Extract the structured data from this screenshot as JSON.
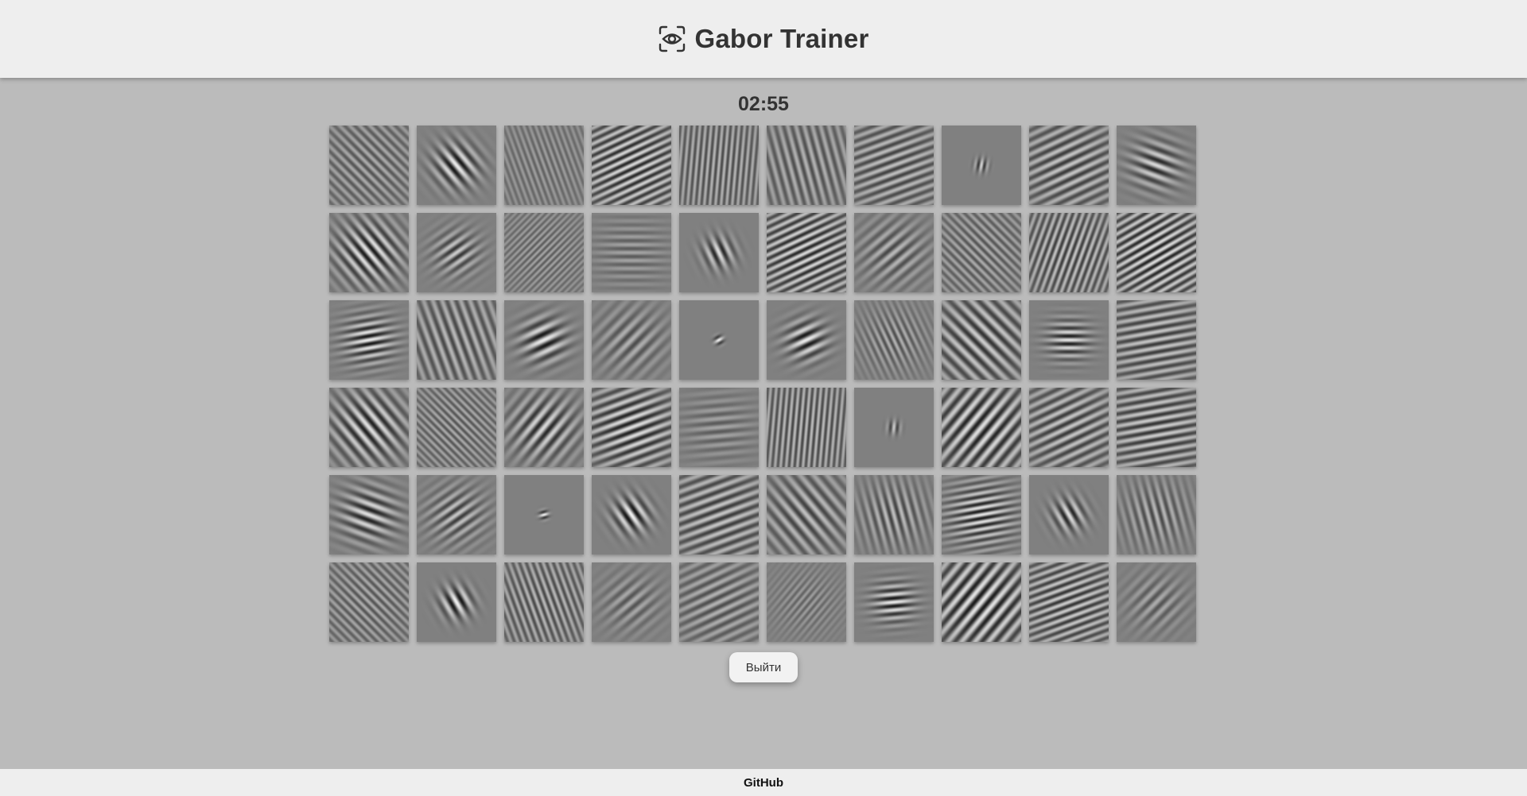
{
  "header": {
    "title": "Gabor Trainer",
    "logo_icon": "eye-scan-icon"
  },
  "timer": {
    "value": "02:55"
  },
  "grid": {
    "rows": 6,
    "cols": 10,
    "patches": [
      [
        {
          "angle": 135,
          "wavelength": 9,
          "sigma": 60,
          "contrast": 0.35
        },
        {
          "angle": 140,
          "wavelength": 13,
          "sigma": 20,
          "contrast": 0.85
        },
        {
          "angle": 160,
          "wavelength": 7,
          "sigma": 60,
          "contrast": 0.25
        },
        {
          "angle": 65,
          "wavelength": 9,
          "sigma": 60,
          "contrast": 0.7
        },
        {
          "angle": 5,
          "wavelength": 7,
          "sigma": 70,
          "contrast": 0.45
        },
        {
          "angle": 165,
          "wavelength": 10,
          "sigma": 60,
          "contrast": 0.4
        },
        {
          "angle": 70,
          "wavelength": 10,
          "sigma": 60,
          "contrast": 0.5
        },
        {
          "angle": 10,
          "wavelength": 8,
          "sigma": 6,
          "contrast": 0.7
        },
        {
          "angle": 65,
          "wavelength": 11,
          "sigma": 55,
          "contrast": 0.55
        },
        {
          "angle": 110,
          "wavelength": 13,
          "sigma": 22,
          "contrast": 0.7
        }
      ],
      [
        {
          "angle": 140,
          "wavelength": 12,
          "sigma": 30,
          "contrast": 0.8
        },
        {
          "angle": 55,
          "wavelength": 11,
          "sigma": 20,
          "contrast": 0.6
        },
        {
          "angle": 45,
          "wavelength": 6,
          "sigma": 50,
          "contrast": 0.3
        },
        {
          "angle": 90,
          "wavelength": 10,
          "sigma": 30,
          "contrast": 0.3
        },
        {
          "angle": 155,
          "wavelength": 12,
          "sigma": 14,
          "contrast": 0.75
        },
        {
          "angle": 65,
          "wavelength": 9,
          "sigma": 60,
          "contrast": 0.7
        },
        {
          "angle": 50,
          "wavelength": 12,
          "sigma": 30,
          "contrast": 0.45
        },
        {
          "angle": 135,
          "wavelength": 8,
          "sigma": 60,
          "contrast": 0.35
        },
        {
          "angle": 20,
          "wavelength": 8,
          "sigma": 60,
          "contrast": 0.55
        },
        {
          "angle": 60,
          "wavelength": 9,
          "sigma": 60,
          "contrast": 0.75
        }
      ],
      [
        {
          "angle": 80,
          "wavelength": 10,
          "sigma": 22,
          "contrast": 0.85
        },
        {
          "angle": 160,
          "wavelength": 11,
          "sigma": 60,
          "contrast": 0.45
        },
        {
          "angle": 65,
          "wavelength": 14,
          "sigma": 20,
          "contrast": 0.85
        },
        {
          "angle": 45,
          "wavelength": 13,
          "sigma": 30,
          "contrast": 0.4
        },
        {
          "angle": 60,
          "wavelength": 9,
          "sigma": 4,
          "contrast": 0.9
        },
        {
          "angle": 65,
          "wavelength": 13,
          "sigma": 18,
          "contrast": 0.85
        },
        {
          "angle": 155,
          "wavelength": 8,
          "sigma": 30,
          "contrast": 0.4
        },
        {
          "angle": 135,
          "wavelength": 13,
          "sigma": 55,
          "contrast": 0.6
        },
        {
          "angle": 90,
          "wavelength": 10,
          "sigma": 18,
          "contrast": 0.8
        },
        {
          "angle": 80,
          "wavelength": 10,
          "sigma": 60,
          "contrast": 0.55
        }
      ],
      [
        {
          "angle": 140,
          "wavelength": 13,
          "sigma": 35,
          "contrast": 0.75
        },
        {
          "angle": 135,
          "wavelength": 7,
          "sigma": 60,
          "contrast": 0.35
        },
        {
          "angle": 40,
          "wavelength": 13,
          "sigma": 30,
          "contrast": 0.7
        },
        {
          "angle": 70,
          "wavelength": 11,
          "sigma": 45,
          "contrast": 0.75
        },
        {
          "angle": 85,
          "wavelength": 11,
          "sigma": 30,
          "contrast": 0.3
        },
        {
          "angle": 5,
          "wavelength": 7,
          "sigma": 70,
          "contrast": 0.5
        },
        {
          "angle": 5,
          "wavelength": 9,
          "sigma": 6,
          "contrast": 0.6
        },
        {
          "angle": 40,
          "wavelength": 13,
          "sigma": 55,
          "contrast": 0.75
        },
        {
          "angle": 65,
          "wavelength": 11,
          "sigma": 55,
          "contrast": 0.55
        },
        {
          "angle": 80,
          "wavelength": 10,
          "sigma": 60,
          "contrast": 0.6
        }
      ],
      [
        {
          "angle": 110,
          "wavelength": 13,
          "sigma": 25,
          "contrast": 0.75
        },
        {
          "angle": 55,
          "wavelength": 11,
          "sigma": 25,
          "contrast": 0.55
        },
        {
          "angle": 75,
          "wavelength": 8,
          "sigma": 4,
          "contrast": 0.9
        },
        {
          "angle": 145,
          "wavelength": 13,
          "sigma": 16,
          "contrast": 0.9
        },
        {
          "angle": 70,
          "wavelength": 11,
          "sigma": 60,
          "contrast": 0.55
        },
        {
          "angle": 140,
          "wavelength": 13,
          "sigma": 45,
          "contrast": 0.5
        },
        {
          "angle": 165,
          "wavelength": 10,
          "sigma": 30,
          "contrast": 0.5
        },
        {
          "angle": 80,
          "wavelength": 9,
          "sigma": 30,
          "contrast": 0.8
        },
        {
          "angle": 150,
          "wavelength": 12,
          "sigma": 15,
          "contrast": 0.75
        },
        {
          "angle": 165,
          "wavelength": 10,
          "sigma": 30,
          "contrast": 0.45
        }
      ],
      [
        {
          "angle": 135,
          "wavelength": 8,
          "sigma": 60,
          "contrast": 0.35
        },
        {
          "angle": 150,
          "wavelength": 13,
          "sigma": 14,
          "contrast": 0.9
        },
        {
          "angle": 160,
          "wavelength": 8,
          "sigma": 60,
          "contrast": 0.45
        },
        {
          "angle": 50,
          "wavelength": 12,
          "sigma": 25,
          "contrast": 0.35
        },
        {
          "angle": 65,
          "wavelength": 11,
          "sigma": 50,
          "contrast": 0.4
        },
        {
          "angle": 40,
          "wavelength": 7,
          "sigma": 30,
          "contrast": 0.25
        },
        {
          "angle": 85,
          "wavelength": 10,
          "sigma": 18,
          "contrast": 0.85
        },
        {
          "angle": 40,
          "wavelength": 13,
          "sigma": 55,
          "contrast": 0.8
        },
        {
          "angle": 70,
          "wavelength": 9,
          "sigma": 60,
          "contrast": 0.6
        },
        {
          "angle": 45,
          "wavelength": 12,
          "sigma": 25,
          "contrast": 0.35
        }
      ]
    ]
  },
  "exit_button": {
    "label": "Выйти"
  },
  "footer": {
    "link_label": "GitHub"
  }
}
